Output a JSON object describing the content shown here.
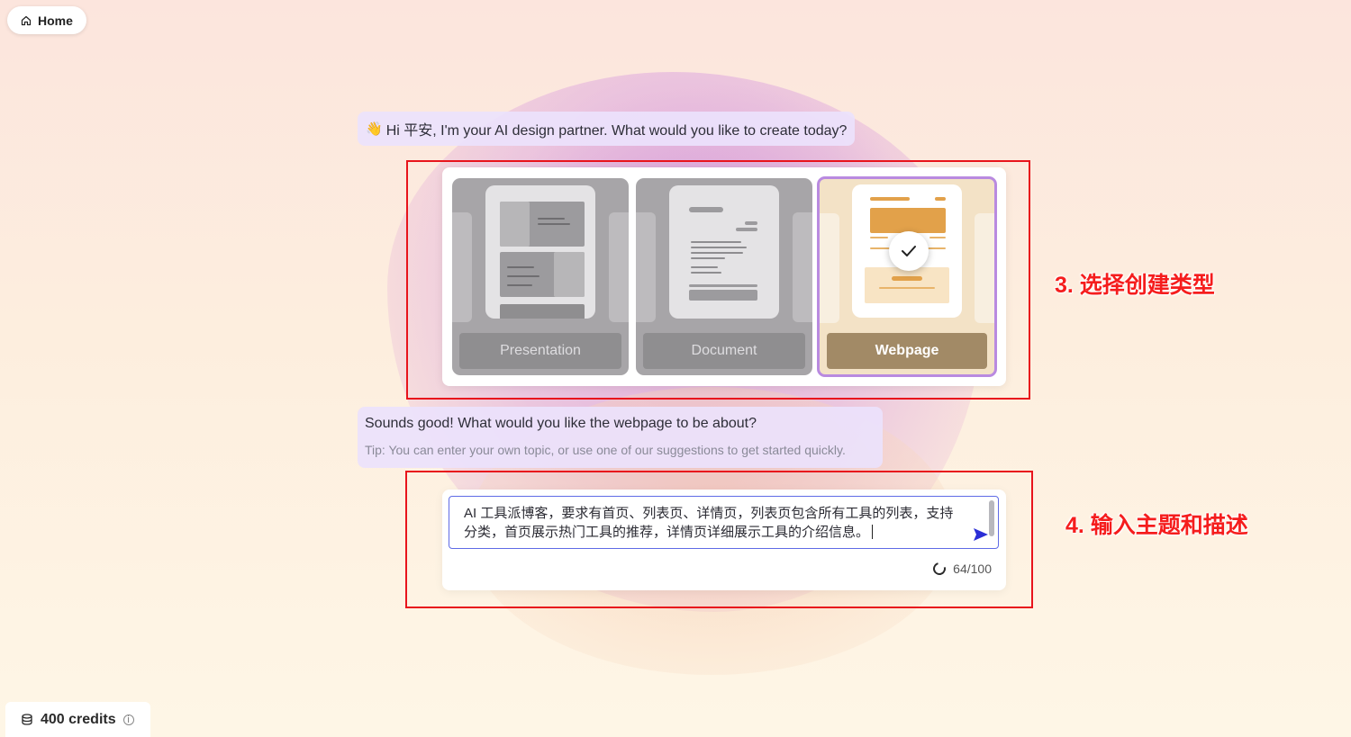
{
  "nav": {
    "home_label": "Home"
  },
  "chat": {
    "greeting_emoji": "👋",
    "greeting": "Hi 平安, I'm your AI design partner. What would you like to create today?",
    "reply": "Sounds good! What would you like the webpage to be about?",
    "tip": "Tip: You can enter your own topic, or use one of our suggestions to get started quickly."
  },
  "types": [
    {
      "label": "Presentation",
      "selected": false
    },
    {
      "label": "Document",
      "selected": false
    },
    {
      "label": "Webpage",
      "selected": true
    }
  ],
  "input": {
    "value": "AI 工具派博客，要求有首页、列表页、详情页，列表页包含所有工具的列表，支持分类，首页展示热门工具的推荐，详情页详细展示工具的介绍信息。",
    "counter": "64/100"
  },
  "annotations": {
    "step3": "3. 选择创建类型",
    "step4": "4. 输入主题和描述"
  },
  "credits": {
    "label": "400 credits"
  },
  "colors": {
    "accent": "#5f6be6",
    "selection": "#b98ae0",
    "annotation": "#e8141c"
  }
}
